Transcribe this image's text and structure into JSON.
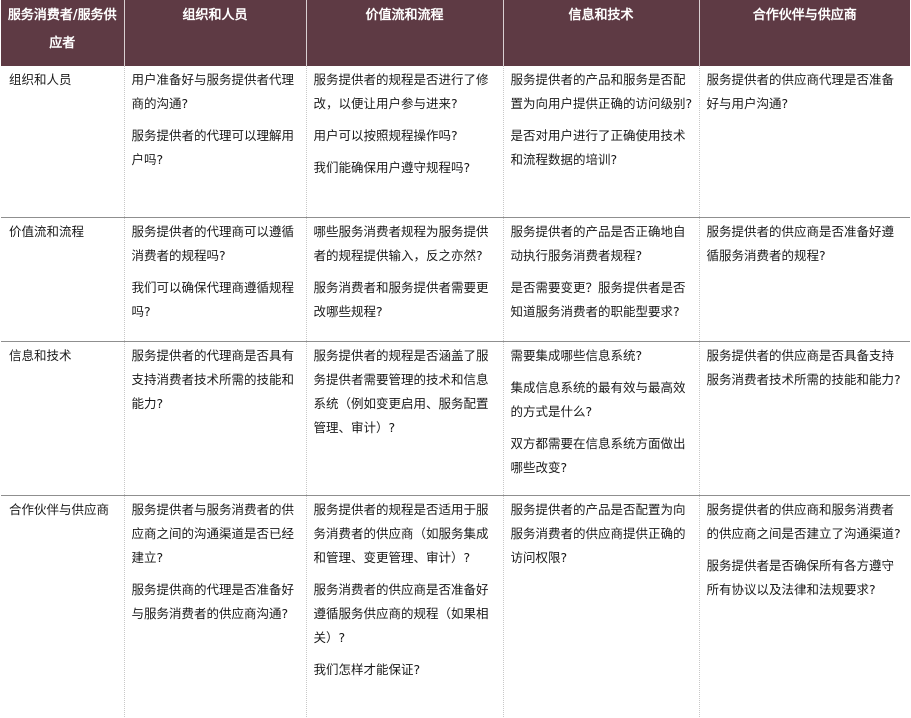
{
  "header": {
    "corner": "服务消费者/服务供应者",
    "columns": [
      "组织和人员",
      "价值流和流程",
      "信息和技术",
      "合作伙伴与供应商"
    ]
  },
  "rows": [
    {
      "label": "组织和人员",
      "cells": [
        [
          "用户准备好与服务提供者代理商的沟通?",
          "服务提供者的代理可以理解用户吗?"
        ],
        [
          "服务提供者的规程是否进行了修改，以便让用户参与进来?",
          "用户可以按照规程操作吗?",
          "我们能确保用户遵守规程吗?"
        ],
        [
          "服务提供者的产品和服务是否配置为向用户提供正确的访问级别?",
          "是否对用户进行了正确使用技术和流程数据的培训?"
        ],
        [
          "服务提供者的供应商代理是否准备好与用户沟通?"
        ]
      ]
    },
    {
      "label": "价值流和流程",
      "cells": [
        [
          "服务提供者的代理商可以遵循消费者的规程吗?",
          "我们可以确保代理商遵循规程吗?"
        ],
        [
          "哪些服务消费者规程为服务提供者的规程提供输入，反之亦然?",
          "服务消费者和服务提供者需要更改哪些规程?"
        ],
        [
          "服务提供者的产品是否正确地自动执行服务消费者规程?",
          "是否需要变更？服务提供者是否知道服务消费者的职能型要求?"
        ],
        [
          "服务提供者的供应商是否准备好遵循服务消费者的规程?"
        ]
      ]
    },
    {
      "label": "信息和技术",
      "cells": [
        [
          "服务提供者的代理商是否具有支持消费者技术所需的技能和能力?"
        ],
        [
          "服务提供者的规程是否涵盖了服务提供者需要管理的技术和信息系统（例如变更启用、服务配置管理、审计）?"
        ],
        [
          "需要集成哪些信息系统?",
          "集成信息系统的最有效与最高效的方式是什么?",
          "双方都需要在信息系统方面做出哪些改变?"
        ],
        [
          "服务提供者的供应商是否具备支持服务消费者技术所需的技能和能力?"
        ]
      ]
    },
    {
      "label": "合作伙伴与供应商",
      "cells": [
        [
          "服务提供者与服务消费者的供应商之间的沟通渠道是否已经建立?",
          "服务提供商的代理是否准备好与服务消费者的供应商沟通?"
        ],
        [
          "服务提供者的规程是否适用于服务消费者的供应商（如服务集成和管理、变更管理、审计）?",
          "服务消费者的供应商是否准备好遵循服务供应商的规程（如果相关）?",
          "我们怎样才能保证?"
        ],
        [
          "服务提供者的产品是否配置为向服务消费者的供应商提供正确的访问权限?"
        ],
        [
          "服务提供者的供应商和服务消费者的供应商之间是否建立了沟通渠道?",
          "服务提供者是否确保所有各方遵守所有协议以及法律和法规要求?"
        ]
      ]
    }
  ]
}
